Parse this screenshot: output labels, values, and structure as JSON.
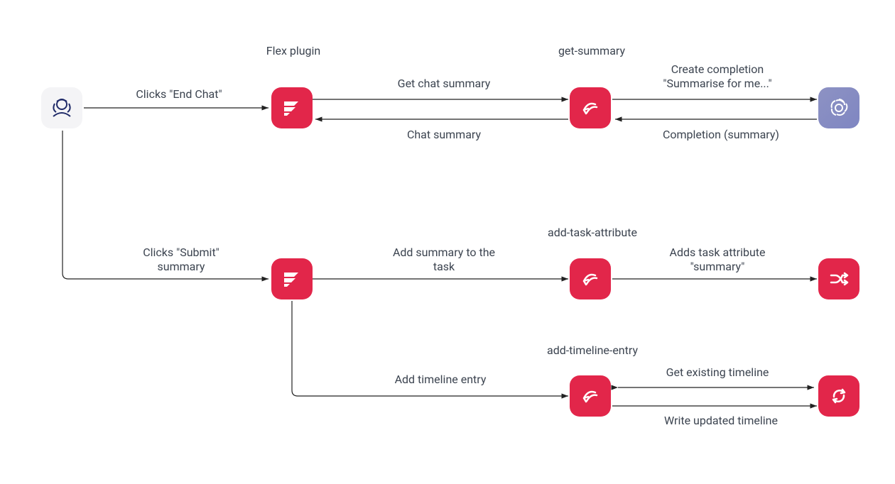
{
  "nodes": {
    "agent": {
      "icon": "agent"
    },
    "flex_plugin": {
      "title": "Flex plugin"
    },
    "get_summary": {
      "title": "get-summary"
    },
    "openai": {
      "icon": "openai"
    },
    "flex_plugin_2": {
      "icon": "flex-plugin"
    },
    "add_task_attribute": {
      "title": "add-task-attribute"
    },
    "router": {
      "icon": "router"
    },
    "add_timeline_entry": {
      "title": "add-timeline-entry"
    },
    "sync": {
      "icon": "sync"
    }
  },
  "edges": {
    "clicks_end_chat": "Clicks \"End Chat\"",
    "get_chat_summary": "Get chat summary",
    "chat_summary": "Chat summary",
    "create_completion": "Create completion\n\"Summarise for me...\"",
    "completion_summary": "Completion (summary)",
    "clicks_submit": "Clicks \"Submit\"\nsummary",
    "add_summary_to_task": "Add summary to the\ntask",
    "adds_task_attribute": "Adds task attribute\n\"summary\"",
    "add_timeline_entry_lbl": "Add timeline entry",
    "get_existing_timeline": "Get existing timeline",
    "write_updated_timeline": "Write updated timeline"
  },
  "colors": {
    "red": "#e2264a",
    "arrow": "#222222",
    "text": "#3c4450"
  }
}
